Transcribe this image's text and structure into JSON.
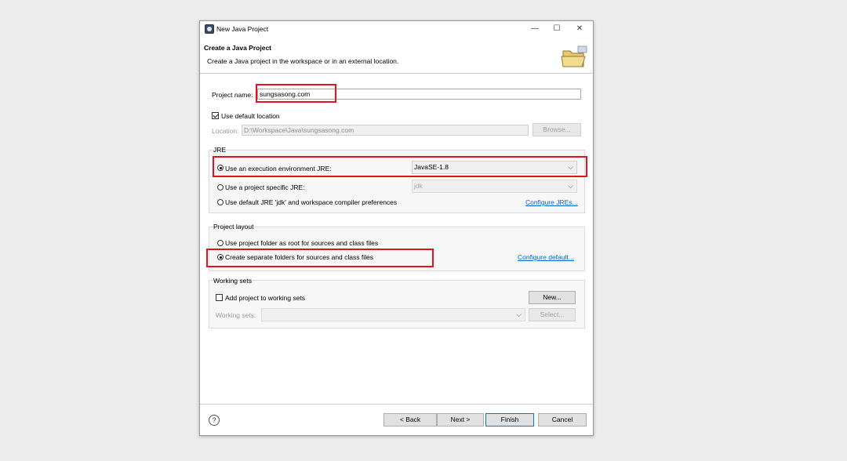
{
  "window": {
    "title": "New Java Project"
  },
  "header": {
    "title": "Create a Java Project",
    "description": "Create a Java project in the workspace or in an external location."
  },
  "project_name": {
    "label": "Project name:",
    "value": "sungsasong.com"
  },
  "default_location": {
    "checkbox_label": "Use default location",
    "checked": true,
    "location_label": "Location:",
    "location_value": "D:\\Workspace\\Java\\sungsasong.com",
    "browse_label": "Browse..."
  },
  "jre": {
    "title": "JRE",
    "option_env_label": "Use an execution environment JRE:",
    "env_value": "JavaSE-1.8",
    "option_specific_label": "Use a project specific JRE:",
    "specific_value": "jdk",
    "option_default_label": "Use default JRE 'jdk' and workspace compiler preferences",
    "configure_link": "Configure JREs..."
  },
  "layout": {
    "title": "Project layout",
    "option_root_label": "Use project folder as root for sources and class files",
    "option_separate_label": "Create separate folders for sources and class files",
    "configure_link": "Configure default..."
  },
  "working_sets": {
    "title": "Working sets",
    "checkbox_label": "Add project to working sets",
    "new_label": "New...",
    "sets_label": "Working sets:",
    "select_label": "Select..."
  },
  "footer": {
    "help_icon": "help-icon",
    "back_label": "< Back",
    "next_label": "Next >",
    "finish_label": "Finish",
    "cancel_label": "Cancel"
  },
  "colors": {
    "highlight": "#e0141b",
    "link": "#0066cc",
    "focus": "#0078d7"
  }
}
